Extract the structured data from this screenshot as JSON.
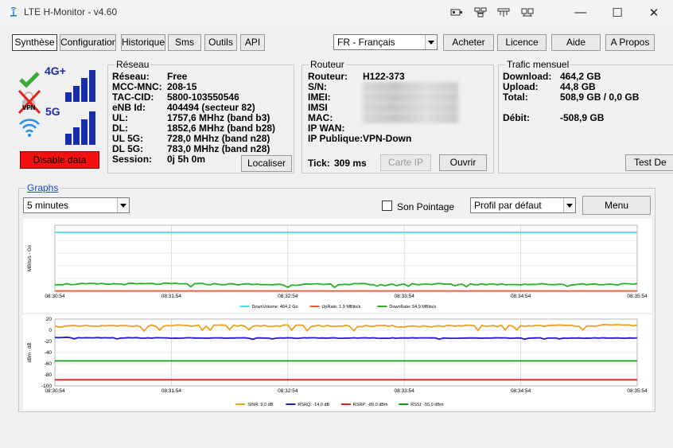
{
  "window": {
    "title": "LTE H-Monitor - v4.60",
    "minimize": "—",
    "maximize": "☐",
    "close": "✕"
  },
  "toolbar": {
    "tabs": [
      "Synthèse",
      "Configuration",
      "Historique",
      "Sms",
      "Outils",
      "API"
    ],
    "language": "FR - Français",
    "buttons": [
      "Acheter",
      "Licence",
      "Aide",
      "A Propos"
    ]
  },
  "status": {
    "network_badge": "4G+",
    "network_badge_5g": "5G",
    "vpn_label": "VPN",
    "disable_data": "Disable data"
  },
  "reseau": {
    "title": "Réseau",
    "rows": [
      {
        "label": "Réseau:",
        "value": "Free"
      },
      {
        "label": "MCC-MNC:",
        "value": "208-15"
      },
      {
        "label": "TAC-CID:",
        "value": "5800-103550546"
      },
      {
        "label": "eNB Id:",
        "value": "404494 (secteur 82)"
      },
      {
        "label": "UL:",
        "value": "1757,6 MHhz (band b3)"
      },
      {
        "label": "DL:",
        "value": "1852,6 MHhz (band b28)"
      },
      {
        "label": "UL 5G:",
        "value": "728,0 MHhz (band n28)"
      },
      {
        "label": "DL 5G:",
        "value": "783,0 MHhz (band n28)"
      },
      {
        "label": "Session:",
        "value": "0j 5h 0m"
      }
    ],
    "localiser": "Localiser"
  },
  "routeur": {
    "title": "Routeur",
    "rows": [
      {
        "label": "Routeur:",
        "value": "H122-373"
      },
      {
        "label": "S/N:",
        "value": ""
      },
      {
        "label": "IMEI:",
        "value": ""
      },
      {
        "label": "IMSI",
        "value": ""
      },
      {
        "label": "MAC:",
        "value": ""
      },
      {
        "label": "IP WAN:",
        "value": ""
      },
      {
        "label": "IP Publique:",
        "value": "VPN-Down"
      }
    ],
    "tick_label": "Tick:",
    "tick_value": "309 ms",
    "carte_ip": "Carte IP",
    "ouvrir": "Ouvrir"
  },
  "trafic": {
    "title": "Trafic mensuel",
    "rows": [
      {
        "label": "Download:",
        "value": "464,2 GB"
      },
      {
        "label": "Upload:",
        "value": "44,8 GB"
      },
      {
        "label": "Total:",
        "value": "508,9 GB / 0,0 GB"
      }
    ],
    "debit_label": "Débit:",
    "debit_value": "-508,9 GB",
    "test_button": "Test De"
  },
  "graphs": {
    "title": "Graphs",
    "period": "5 minutes",
    "son_pointage": "Son Pointage",
    "profil": "Profil par défaut",
    "menu": "Menu"
  },
  "chart_data": [
    {
      "type": "line",
      "ylabel": "MBits/s - Go",
      "x": [
        "08:30:54",
        "08:31:54",
        "08:32:54",
        "08:33:54",
        "08:34:54",
        "08:35:54"
      ],
      "series": [
        {
          "name": "DownVolume: 464,2 Go",
          "color": "#4fd9f2",
          "values": [
            464.2,
            464.2,
            464.2,
            464.2,
            464.2,
            464.2
          ]
        },
        {
          "name": "UpRate: 1,9 MBits/s",
          "color": "#f25c3c",
          "values": [
            1.9,
            1.9,
            1.9,
            1.9,
            1.9,
            1.9
          ]
        },
        {
          "name": "DownRate: 54,9 MBits/s",
          "color": "#23b423",
          "values": [
            56,
            58,
            52,
            57,
            55,
            54.9
          ]
        }
      ]
    },
    {
      "type": "line",
      "ylabel": "dBm - dB",
      "x": [
        "08:30:54",
        "08:31:54",
        "08:32:54",
        "08:33:54",
        "08:34:54",
        "08:35:54"
      ],
      "yticks": [
        20,
        0,
        -20,
        -40,
        -60,
        -80,
        -100
      ],
      "ylim": [
        -100,
        20
      ],
      "series": [
        {
          "name": "SINR: 9,0 dB",
          "color": "#f0a020",
          "values": [
            7,
            8,
            8,
            7,
            8,
            9
          ]
        },
        {
          "name": "RSRQ: -14,0 dB",
          "color": "#1a1ad0",
          "values": [
            -13,
            -14,
            -14,
            -14,
            -14,
            -14
          ]
        },
        {
          "name": "RSRP: -89,0 dBm",
          "color": "#e81c1c",
          "values": [
            -89,
            -89,
            -89,
            -89,
            -89,
            -89
          ]
        },
        {
          "name": "RSSI: -55,0 dBm",
          "color": "#169a16",
          "values": [
            -55,
            -55,
            -55,
            -55,
            -55,
            -55
          ]
        }
      ]
    }
  ]
}
